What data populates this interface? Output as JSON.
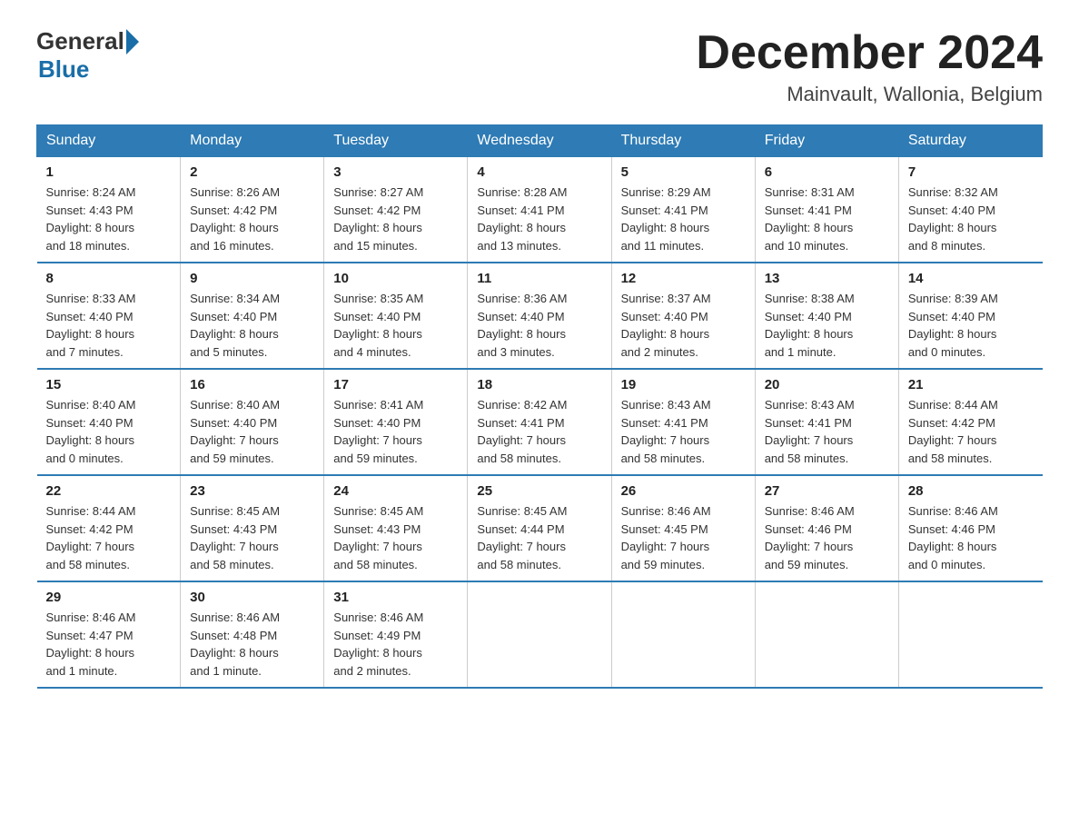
{
  "header": {
    "logo_general": "General",
    "logo_blue": "Blue",
    "month_title": "December 2024",
    "location": "Mainvault, Wallonia, Belgium"
  },
  "columns": [
    "Sunday",
    "Monday",
    "Tuesday",
    "Wednesday",
    "Thursday",
    "Friday",
    "Saturday"
  ],
  "weeks": [
    [
      {
        "day": "1",
        "info": "Sunrise: 8:24 AM\nSunset: 4:43 PM\nDaylight: 8 hours\nand 18 minutes."
      },
      {
        "day": "2",
        "info": "Sunrise: 8:26 AM\nSunset: 4:42 PM\nDaylight: 8 hours\nand 16 minutes."
      },
      {
        "day": "3",
        "info": "Sunrise: 8:27 AM\nSunset: 4:42 PM\nDaylight: 8 hours\nand 15 minutes."
      },
      {
        "day": "4",
        "info": "Sunrise: 8:28 AM\nSunset: 4:41 PM\nDaylight: 8 hours\nand 13 minutes."
      },
      {
        "day": "5",
        "info": "Sunrise: 8:29 AM\nSunset: 4:41 PM\nDaylight: 8 hours\nand 11 minutes."
      },
      {
        "day": "6",
        "info": "Sunrise: 8:31 AM\nSunset: 4:41 PM\nDaylight: 8 hours\nand 10 minutes."
      },
      {
        "day": "7",
        "info": "Sunrise: 8:32 AM\nSunset: 4:40 PM\nDaylight: 8 hours\nand 8 minutes."
      }
    ],
    [
      {
        "day": "8",
        "info": "Sunrise: 8:33 AM\nSunset: 4:40 PM\nDaylight: 8 hours\nand 7 minutes."
      },
      {
        "day": "9",
        "info": "Sunrise: 8:34 AM\nSunset: 4:40 PM\nDaylight: 8 hours\nand 5 minutes."
      },
      {
        "day": "10",
        "info": "Sunrise: 8:35 AM\nSunset: 4:40 PM\nDaylight: 8 hours\nand 4 minutes."
      },
      {
        "day": "11",
        "info": "Sunrise: 8:36 AM\nSunset: 4:40 PM\nDaylight: 8 hours\nand 3 minutes."
      },
      {
        "day": "12",
        "info": "Sunrise: 8:37 AM\nSunset: 4:40 PM\nDaylight: 8 hours\nand 2 minutes."
      },
      {
        "day": "13",
        "info": "Sunrise: 8:38 AM\nSunset: 4:40 PM\nDaylight: 8 hours\nand 1 minute."
      },
      {
        "day": "14",
        "info": "Sunrise: 8:39 AM\nSunset: 4:40 PM\nDaylight: 8 hours\nand 0 minutes."
      }
    ],
    [
      {
        "day": "15",
        "info": "Sunrise: 8:40 AM\nSunset: 4:40 PM\nDaylight: 8 hours\nand 0 minutes."
      },
      {
        "day": "16",
        "info": "Sunrise: 8:40 AM\nSunset: 4:40 PM\nDaylight: 7 hours\nand 59 minutes."
      },
      {
        "day": "17",
        "info": "Sunrise: 8:41 AM\nSunset: 4:40 PM\nDaylight: 7 hours\nand 59 minutes."
      },
      {
        "day": "18",
        "info": "Sunrise: 8:42 AM\nSunset: 4:41 PM\nDaylight: 7 hours\nand 58 minutes."
      },
      {
        "day": "19",
        "info": "Sunrise: 8:43 AM\nSunset: 4:41 PM\nDaylight: 7 hours\nand 58 minutes."
      },
      {
        "day": "20",
        "info": "Sunrise: 8:43 AM\nSunset: 4:41 PM\nDaylight: 7 hours\nand 58 minutes."
      },
      {
        "day": "21",
        "info": "Sunrise: 8:44 AM\nSunset: 4:42 PM\nDaylight: 7 hours\nand 58 minutes."
      }
    ],
    [
      {
        "day": "22",
        "info": "Sunrise: 8:44 AM\nSunset: 4:42 PM\nDaylight: 7 hours\nand 58 minutes."
      },
      {
        "day": "23",
        "info": "Sunrise: 8:45 AM\nSunset: 4:43 PM\nDaylight: 7 hours\nand 58 minutes."
      },
      {
        "day": "24",
        "info": "Sunrise: 8:45 AM\nSunset: 4:43 PM\nDaylight: 7 hours\nand 58 minutes."
      },
      {
        "day": "25",
        "info": "Sunrise: 8:45 AM\nSunset: 4:44 PM\nDaylight: 7 hours\nand 58 minutes."
      },
      {
        "day": "26",
        "info": "Sunrise: 8:46 AM\nSunset: 4:45 PM\nDaylight: 7 hours\nand 59 minutes."
      },
      {
        "day": "27",
        "info": "Sunrise: 8:46 AM\nSunset: 4:46 PM\nDaylight: 7 hours\nand 59 minutes."
      },
      {
        "day": "28",
        "info": "Sunrise: 8:46 AM\nSunset: 4:46 PM\nDaylight: 8 hours\nand 0 minutes."
      }
    ],
    [
      {
        "day": "29",
        "info": "Sunrise: 8:46 AM\nSunset: 4:47 PM\nDaylight: 8 hours\nand 1 minute."
      },
      {
        "day": "30",
        "info": "Sunrise: 8:46 AM\nSunset: 4:48 PM\nDaylight: 8 hours\nand 1 minute."
      },
      {
        "day": "31",
        "info": "Sunrise: 8:46 AM\nSunset: 4:49 PM\nDaylight: 8 hours\nand 2 minutes."
      },
      null,
      null,
      null,
      null
    ]
  ]
}
